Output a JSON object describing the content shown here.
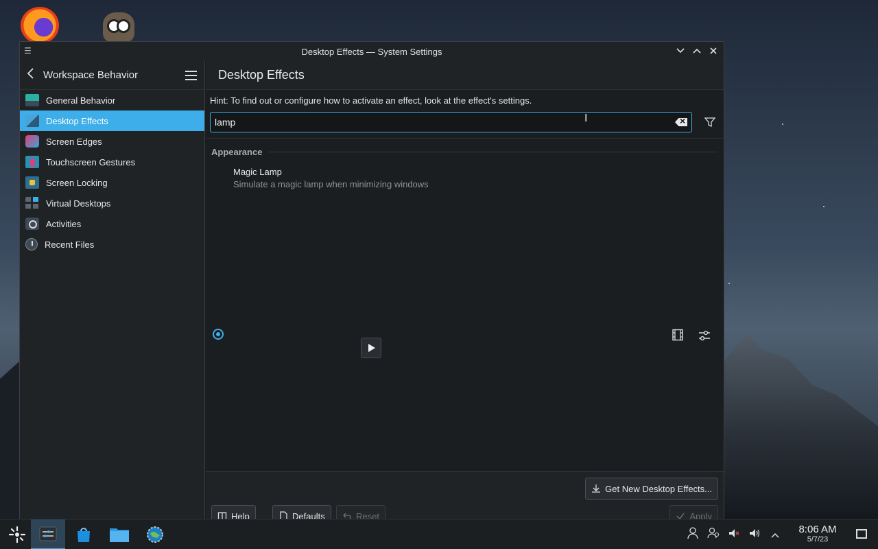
{
  "window": {
    "title": "Desktop Effects — System Settings"
  },
  "sidebar": {
    "heading": "Workspace Behavior",
    "items": [
      {
        "label": "General Behavior",
        "icon": "general-behavior-icon",
        "active": false
      },
      {
        "label": "Desktop Effects",
        "icon": "desktop-effects-icon",
        "active": true
      },
      {
        "label": "Screen Edges",
        "icon": "screen-edges-icon",
        "active": false
      },
      {
        "label": "Touchscreen Gestures",
        "icon": "touchscreen-gestures-icon",
        "active": false
      },
      {
        "label": "Screen Locking",
        "icon": "screen-locking-icon",
        "active": false
      },
      {
        "label": "Virtual Desktops",
        "icon": "virtual-desktops-icon",
        "active": false
      },
      {
        "label": "Activities",
        "icon": "activities-icon",
        "active": false
      },
      {
        "label": "Recent Files",
        "icon": "recent-files-icon",
        "active": false
      }
    ]
  },
  "main": {
    "title": "Desktop Effects",
    "hint": "Hint: To find out or configure how to activate an effect, look at the effect's settings.",
    "search": {
      "value": "lamp"
    },
    "section": "Appearance",
    "effect": {
      "name": "Magic Lamp",
      "description": "Simulate a magic lamp when minimizing windows",
      "selected": true
    }
  },
  "footer": {
    "get_new": "Get New Desktop Effects...",
    "help": "Help",
    "defaults": "Defaults",
    "reset": "Reset",
    "apply": "Apply"
  },
  "taskbar": {
    "time": "8:06 AM",
    "date": "5/7/23"
  },
  "colors": {
    "accent": "#3daee9",
    "window_bg": "#1b1e20",
    "sidebar_bg": "#202326"
  }
}
